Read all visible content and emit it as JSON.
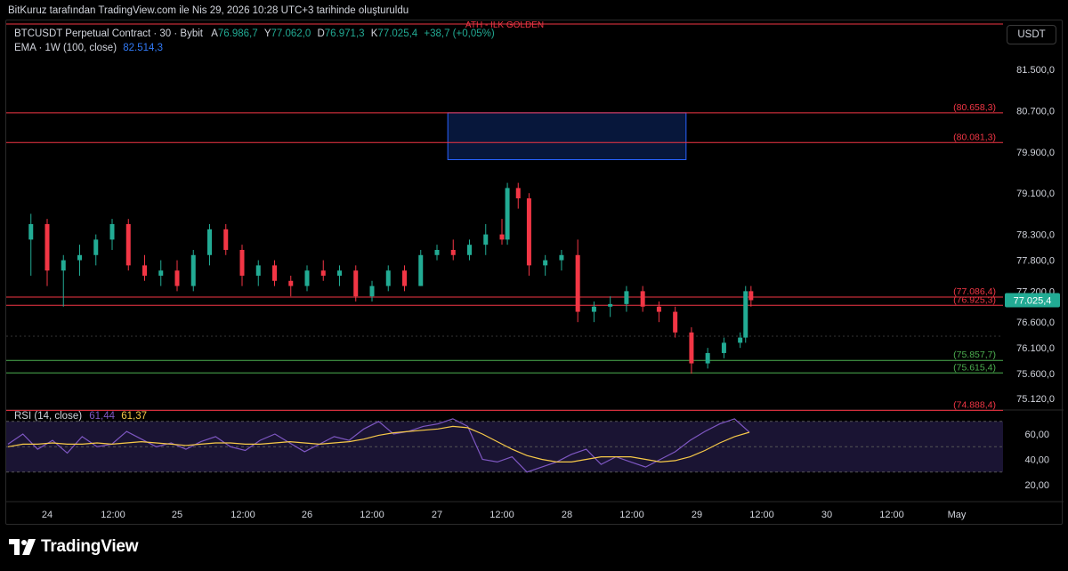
{
  "caption": "BitKuruz tarafından TradingView.com ile Nis 29, 2026 10:28 UTC+3 tarihinde oluşturuldu",
  "legend": {
    "symbol": "BTCUSDT Perpetual Contract · 30 · Bybit",
    "o_key": "A",
    "o_val": "76.986,7",
    "h_key": "Y",
    "h_val": "77.062,0",
    "l_key": "D",
    "l_val": "76.971,3",
    "c_key": "K",
    "c_val": "77.025,4",
    "change": "+38,7 (+0,05%)",
    "ema_label": "EMA · 1W (100, close)",
    "ema_value": "82.514,3"
  },
  "rsi_legend": {
    "label": "RSI (14, close)",
    "rsi_value": "61,44",
    "ma_value": "61,37"
  },
  "currency_button": "USDT",
  "brand": "TradingView",
  "colors": {
    "up": "#22ab94",
    "down": "#f23645",
    "level_red": "#f23645",
    "level_green": "#4caf50",
    "zone_fill": "#0d2a6b",
    "zone_border": "#2962ff",
    "rsi_line": "#7e57c2",
    "rsi_ma": "#f7c948",
    "rsi_band": "#1a1433",
    "price_tag": "#22ab94"
  },
  "chart_data": {
    "type": "candlestick",
    "symbol": "BTCUSDT Perpetual Contract",
    "interval": "30",
    "exchange": "Bybit",
    "price_axis_ticks": [
      "81.500,0",
      "80.700,0",
      "79.900,0",
      "79.100,0",
      "78.300,0",
      "77.800,0",
      "77.200,0",
      "76.600,0",
      "76.100,0",
      "75.600,0",
      "75.120,0"
    ],
    "price_axis_values": [
      81500,
      80700,
      79900,
      79100,
      78300,
      77800,
      77200,
      76600,
      76100,
      75600,
      75120
    ],
    "time_axis_labels": [
      "24",
      "12:00",
      "25",
      "12:00",
      "26",
      "12:00",
      "27",
      "12:00",
      "28",
      "12:00",
      "29",
      "12:00",
      "30",
      "12:00",
      "May"
    ],
    "current_price": {
      "label": "77.025,4",
      "value": 77025.4
    },
    "horizontal_levels": [
      {
        "label": "ATH - ILK GOLDEN",
        "price": 82800,
        "color": "red"
      },
      {
        "label": "(80.658,3)",
        "price": 80658.3,
        "color": "red"
      },
      {
        "label": "(80.081,3)",
        "price": 80081.3,
        "color": "red"
      },
      {
        "label": "(77.086,4)",
        "price": 77086.4,
        "color": "red"
      },
      {
        "label": "(76.925,3)",
        "price": 76925.3,
        "color": "red"
      },
      {
        "label": "(75.857,7)",
        "price": 75857.7,
        "color": "green"
      },
      {
        "label": "(75.615,4)",
        "price": 75615.4,
        "color": "green"
      },
      {
        "label": "(74.888,4)",
        "price": 74888.4,
        "color": "red"
      }
    ],
    "zone": {
      "price_top": 80658.3,
      "price_bottom": 79750,
      "from_time": "27 02:00",
      "to_time": "28 22:00"
    },
    "candles_approx": [
      {
        "t": "23 21:00",
        "o": 78200,
        "h": 78700,
        "l": 77500,
        "c": 78500
      },
      {
        "t": "24 00:00",
        "o": 78500,
        "h": 78600,
        "l": 77300,
        "c": 77600
      },
      {
        "t": "24 03:00",
        "o": 77600,
        "h": 77900,
        "l": 76900,
        "c": 77800
      },
      {
        "t": "24 06:00",
        "o": 77800,
        "h": 78100,
        "l": 77500,
        "c": 77900
      },
      {
        "t": "24 09:00",
        "o": 77900,
        "h": 78300,
        "l": 77700,
        "c": 78200
      },
      {
        "t": "24 12:00",
        "o": 78200,
        "h": 78600,
        "l": 78000,
        "c": 78500
      },
      {
        "t": "24 15:00",
        "o": 78500,
        "h": 78600,
        "l": 77600,
        "c": 77700
      },
      {
        "t": "24 18:00",
        "o": 77700,
        "h": 77900,
        "l": 77400,
        "c": 77500
      },
      {
        "t": "24 21:00",
        "o": 77500,
        "h": 77800,
        "l": 77300,
        "c": 77600
      },
      {
        "t": "25 00:00",
        "o": 77600,
        "h": 77800,
        "l": 77200,
        "c": 77300
      },
      {
        "t": "25 03:00",
        "o": 77300,
        "h": 78000,
        "l": 77200,
        "c": 77900
      },
      {
        "t": "25 06:00",
        "o": 77900,
        "h": 78500,
        "l": 77700,
        "c": 78400
      },
      {
        "t": "25 09:00",
        "o": 78400,
        "h": 78500,
        "l": 77900,
        "c": 78000
      },
      {
        "t": "25 12:00",
        "o": 78000,
        "h": 78100,
        "l": 77300,
        "c": 77500
      },
      {
        "t": "25 15:00",
        "o": 77500,
        "h": 77800,
        "l": 77300,
        "c": 77700
      },
      {
        "t": "25 18:00",
        "o": 77700,
        "h": 77800,
        "l": 77300,
        "c": 77400
      },
      {
        "t": "25 21:00",
        "o": 77400,
        "h": 77500,
        "l": 77100,
        "c": 77300
      },
      {
        "t": "26 00:00",
        "o": 77300,
        "h": 77700,
        "l": 77200,
        "c": 77600
      },
      {
        "t": "26 03:00",
        "o": 77600,
        "h": 77800,
        "l": 77400,
        "c": 77500
      },
      {
        "t": "26 06:00",
        "o": 77500,
        "h": 77700,
        "l": 77300,
        "c": 77600
      },
      {
        "t": "26 09:00",
        "o": 77600,
        "h": 77700,
        "l": 77000,
        "c": 77100
      },
      {
        "t": "26 12:00",
        "o": 77100,
        "h": 77400,
        "l": 77000,
        "c": 77300
      },
      {
        "t": "26 15:00",
        "o": 77300,
        "h": 77700,
        "l": 77200,
        "c": 77600
      },
      {
        "t": "26 18:00",
        "o": 77600,
        "h": 77700,
        "l": 77200,
        "c": 77300
      },
      {
        "t": "26 21:00",
        "o": 77300,
        "h": 78000,
        "l": 77300,
        "c": 77900
      },
      {
        "t": "27 00:00",
        "o": 77900,
        "h": 78100,
        "l": 77800,
        "c": 78000
      },
      {
        "t": "27 03:00",
        "o": 78000,
        "h": 78200,
        "l": 77800,
        "c": 77900
      },
      {
        "t": "27 06:00",
        "o": 77900,
        "h": 78200,
        "l": 77800,
        "c": 78100
      },
      {
        "t": "27 09:00",
        "o": 78100,
        "h": 78500,
        "l": 77900,
        "c": 78300
      },
      {
        "t": "27 12:00",
        "o": 78300,
        "h": 78600,
        "l": 78100,
        "c": 78200
      },
      {
        "t": "27 13:00",
        "o": 78200,
        "h": 79300,
        "l": 78100,
        "c": 79200
      },
      {
        "t": "27 15:00",
        "o": 79200,
        "h": 79300,
        "l": 78800,
        "c": 79000
      },
      {
        "t": "27 17:00",
        "o": 79000,
        "h": 79100,
        "l": 77500,
        "c": 77700
      },
      {
        "t": "27 20:00",
        "o": 77700,
        "h": 77900,
        "l": 77500,
        "c": 77800
      },
      {
        "t": "27 23:00",
        "o": 77800,
        "h": 78000,
        "l": 77600,
        "c": 77900
      },
      {
        "t": "28 02:00",
        "o": 77900,
        "h": 78200,
        "l": 76600,
        "c": 76800
      },
      {
        "t": "28 05:00",
        "o": 76800,
        "h": 77000,
        "l": 76600,
        "c": 76900
      },
      {
        "t": "28 08:00",
        "o": 76900,
        "h": 77100,
        "l": 76700,
        "c": 76950
      },
      {
        "t": "28 11:00",
        "o": 76950,
        "h": 77300,
        "l": 76800,
        "c": 77200
      },
      {
        "t": "28 14:00",
        "o": 77200,
        "h": 77300,
        "l": 76800,
        "c": 76900
      },
      {
        "t": "28 17:00",
        "o": 76900,
        "h": 77000,
        "l": 76600,
        "c": 76800
      },
      {
        "t": "28 20:00",
        "o": 76800,
        "h": 76900,
        "l": 76300,
        "c": 76400
      },
      {
        "t": "28 23:00",
        "o": 76400,
        "h": 76500,
        "l": 75600,
        "c": 75800
      },
      {
        "t": "29 02:00",
        "o": 75800,
        "h": 76100,
        "l": 75700,
        "c": 76000
      },
      {
        "t": "29 05:00",
        "o": 76000,
        "h": 76300,
        "l": 75900,
        "c": 76200
      },
      {
        "t": "29 08:00",
        "o": 76200,
        "h": 76400,
        "l": 76100,
        "c": 76300
      },
      {
        "t": "29 09:00",
        "o": 76300,
        "h": 77300,
        "l": 76200,
        "c": 77200
      },
      {
        "t": "29 10:00",
        "o": 77200,
        "h": 77300,
        "l": 76900,
        "c": 77025.4
      }
    ],
    "ema_1w_100": 82514.3,
    "rsi": {
      "period": 14,
      "value": 61.44,
      "ma_value": 61.37,
      "axis_ticks": [
        "60,00",
        "40,00",
        "20,00"
      ],
      "axis_values": [
        60,
        40,
        20
      ],
      "overbought": 70,
      "middle": 50,
      "oversold": 30,
      "series_approx": [
        52,
        60,
        48,
        55,
        45,
        58,
        50,
        52,
        62,
        56,
        50,
        53,
        48,
        54,
        58,
        50,
        47,
        55,
        60,
        53,
        46,
        52,
        58,
        55,
        64,
        70,
        60,
        62,
        66,
        68,
        72,
        66,
        40,
        38,
        42,
        30,
        34,
        38,
        44,
        48,
        36,
        42,
        38,
        34,
        40,
        46,
        55,
        62,
        68,
        72,
        61.44
      ],
      "ma_series_approx": [
        50,
        52,
        52,
        53,
        52,
        52,
        53,
        52,
        53,
        54,
        53,
        52,
        51,
        52,
        53,
        53,
        52,
        52,
        53,
        54,
        53,
        52,
        53,
        54,
        56,
        59,
        61,
        62,
        63,
        64,
        66,
        65,
        60,
        54,
        48,
        43,
        40,
        38,
        38,
        40,
        42,
        42,
        42,
        40,
        38,
        39,
        42,
        47,
        53,
        58,
        61.37
      ]
    }
  }
}
